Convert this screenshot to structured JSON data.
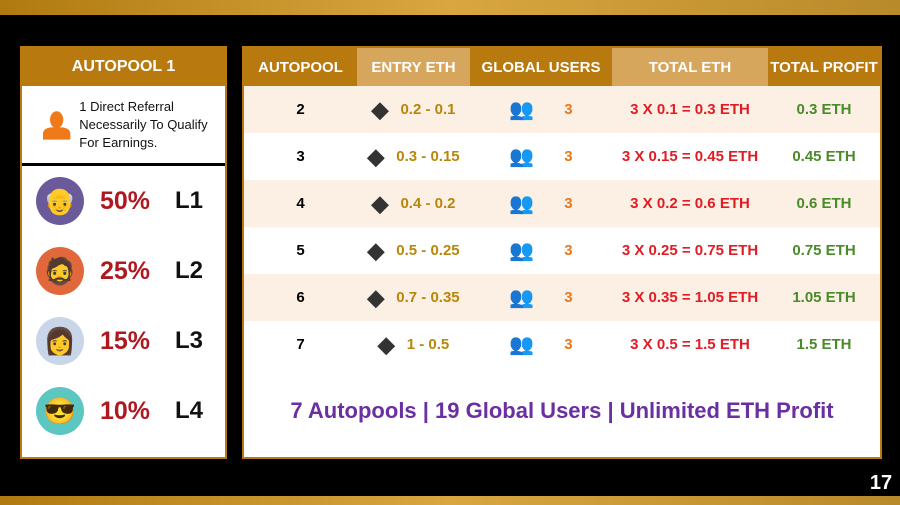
{
  "left": {
    "title": "AUTOPOOL 1",
    "referral_text": "1 Direct Referral Necessarily To Qualify For Earnings.",
    "levels": [
      {
        "percent": "50%",
        "level": "L1",
        "bg": "#6a5a9a"
      },
      {
        "percent": "25%",
        "level": "L2",
        "bg": "#e0683a"
      },
      {
        "percent": "15%",
        "level": "L3",
        "bg": "#c9d6ea"
      },
      {
        "percent": "10%",
        "level": "L4",
        "bg": "#5bc7c0"
      }
    ]
  },
  "table": {
    "headers": [
      "AUTOPOOL",
      "ENTRY ETH",
      "GLOBAL USERS",
      "TOTAL ETH",
      "TOTAL PROFIT"
    ],
    "rows": [
      {
        "autopool": "2",
        "entry": "0.2 - 0.1",
        "users": "3",
        "total": "3 X 0.1 = 0.3 ETH",
        "profit": "0.3 ETH"
      },
      {
        "autopool": "3",
        "entry": "0.3 - 0.15",
        "users": "3",
        "total": "3 X 0.15 = 0.45 ETH",
        "profit": "0.45 ETH"
      },
      {
        "autopool": "4",
        "entry": "0.4 - 0.2",
        "users": "3",
        "total": "3 X 0.2 = 0.6 ETH",
        "profit": "0.6 ETH"
      },
      {
        "autopool": "5",
        "entry": "0.5 - 0.25",
        "users": "3",
        "total": "3 X 0.25 = 0.75 ETH",
        "profit": "0.75 ETH"
      },
      {
        "autopool": "6",
        "entry": "0.7 - 0.35",
        "users": "3",
        "total": "3 X 0.35 = 1.05 ETH",
        "profit": "1.05 ETH"
      },
      {
        "autopool": "7",
        "entry": "1 - 0.5",
        "users": "3",
        "total": "3 X 0.5 = 1.5 ETH",
        "profit": "1.5 ETH"
      }
    ]
  },
  "footer": "7 Autopools |  19 Global Users  | Unlimited ETH Profit",
  "page_number": "17",
  "colors": {
    "gold": "#b8790f",
    "entry": "#b8860b",
    "total": "#e01c24",
    "profit": "#4a8a2a",
    "footer": "#6a2fa0"
  }
}
